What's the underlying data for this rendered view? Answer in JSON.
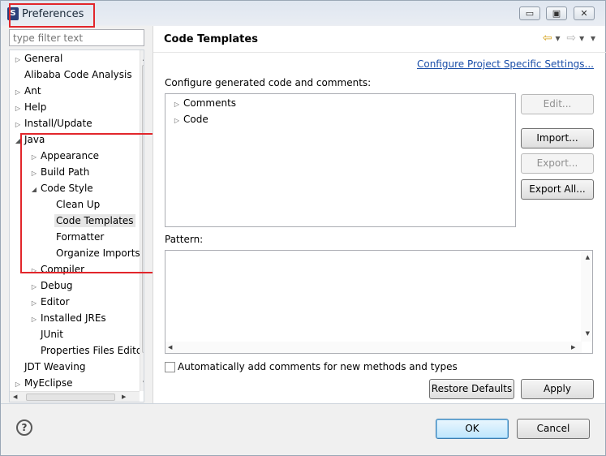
{
  "window": {
    "title": "Preferences",
    "controls": {
      "minimize": "▭",
      "maximize": "▣",
      "close": "✕"
    }
  },
  "filter": {
    "placeholder": "type filter text"
  },
  "tree": [
    {
      "label": "General",
      "indent": 0,
      "arrow": "closed"
    },
    {
      "label": "Alibaba Code Analysis",
      "indent": 0,
      "arrow": "none"
    },
    {
      "label": "Ant",
      "indent": 0,
      "arrow": "closed"
    },
    {
      "label": "Help",
      "indent": 0,
      "arrow": "closed"
    },
    {
      "label": "Install/Update",
      "indent": 0,
      "arrow": "closed"
    },
    {
      "label": "Java",
      "indent": 0,
      "arrow": "open"
    },
    {
      "label": "Appearance",
      "indent": 1,
      "arrow": "closed"
    },
    {
      "label": "Build Path",
      "indent": 1,
      "arrow": "closed"
    },
    {
      "label": "Code Style",
      "indent": 1,
      "arrow": "open"
    },
    {
      "label": "Clean Up",
      "indent": 2,
      "arrow": "none"
    },
    {
      "label": "Code Templates",
      "indent": 2,
      "arrow": "none",
      "selected": true
    },
    {
      "label": "Formatter",
      "indent": 2,
      "arrow": "none"
    },
    {
      "label": "Organize Imports",
      "indent": 2,
      "arrow": "none"
    },
    {
      "label": "Compiler",
      "indent": 1,
      "arrow": "closed"
    },
    {
      "label": "Debug",
      "indent": 1,
      "arrow": "closed"
    },
    {
      "label": "Editor",
      "indent": 1,
      "arrow": "closed"
    },
    {
      "label": "Installed JREs",
      "indent": 1,
      "arrow": "closed"
    },
    {
      "label": "JUnit",
      "indent": 1,
      "arrow": "none"
    },
    {
      "label": "Properties Files Editor",
      "indent": 1,
      "arrow": "none"
    },
    {
      "label": "JDT Weaving",
      "indent": 0,
      "arrow": "none"
    },
    {
      "label": "MyEclipse",
      "indent": 0,
      "arrow": "closed"
    }
  ],
  "page": {
    "title": "Code Templates",
    "configure_link": "Configure Project Specific Settings...",
    "configure_label": "Configure generated code and comments:",
    "template_tree": [
      "Comments",
      "Code"
    ],
    "buttons": {
      "edit": "Edit...",
      "import": "Import...",
      "export": "Export...",
      "export_all": "Export All..."
    },
    "pattern_label": "Pattern:",
    "auto_comments_label": "Automatically add comments for new methods and types",
    "auto_comments_checked": false,
    "restore_defaults": "Restore Defaults",
    "apply": "Apply"
  },
  "footer": {
    "ok": "OK",
    "cancel": "Cancel"
  },
  "colors": {
    "annotation_red": "#e2262b",
    "link": "#1a4ea8"
  }
}
